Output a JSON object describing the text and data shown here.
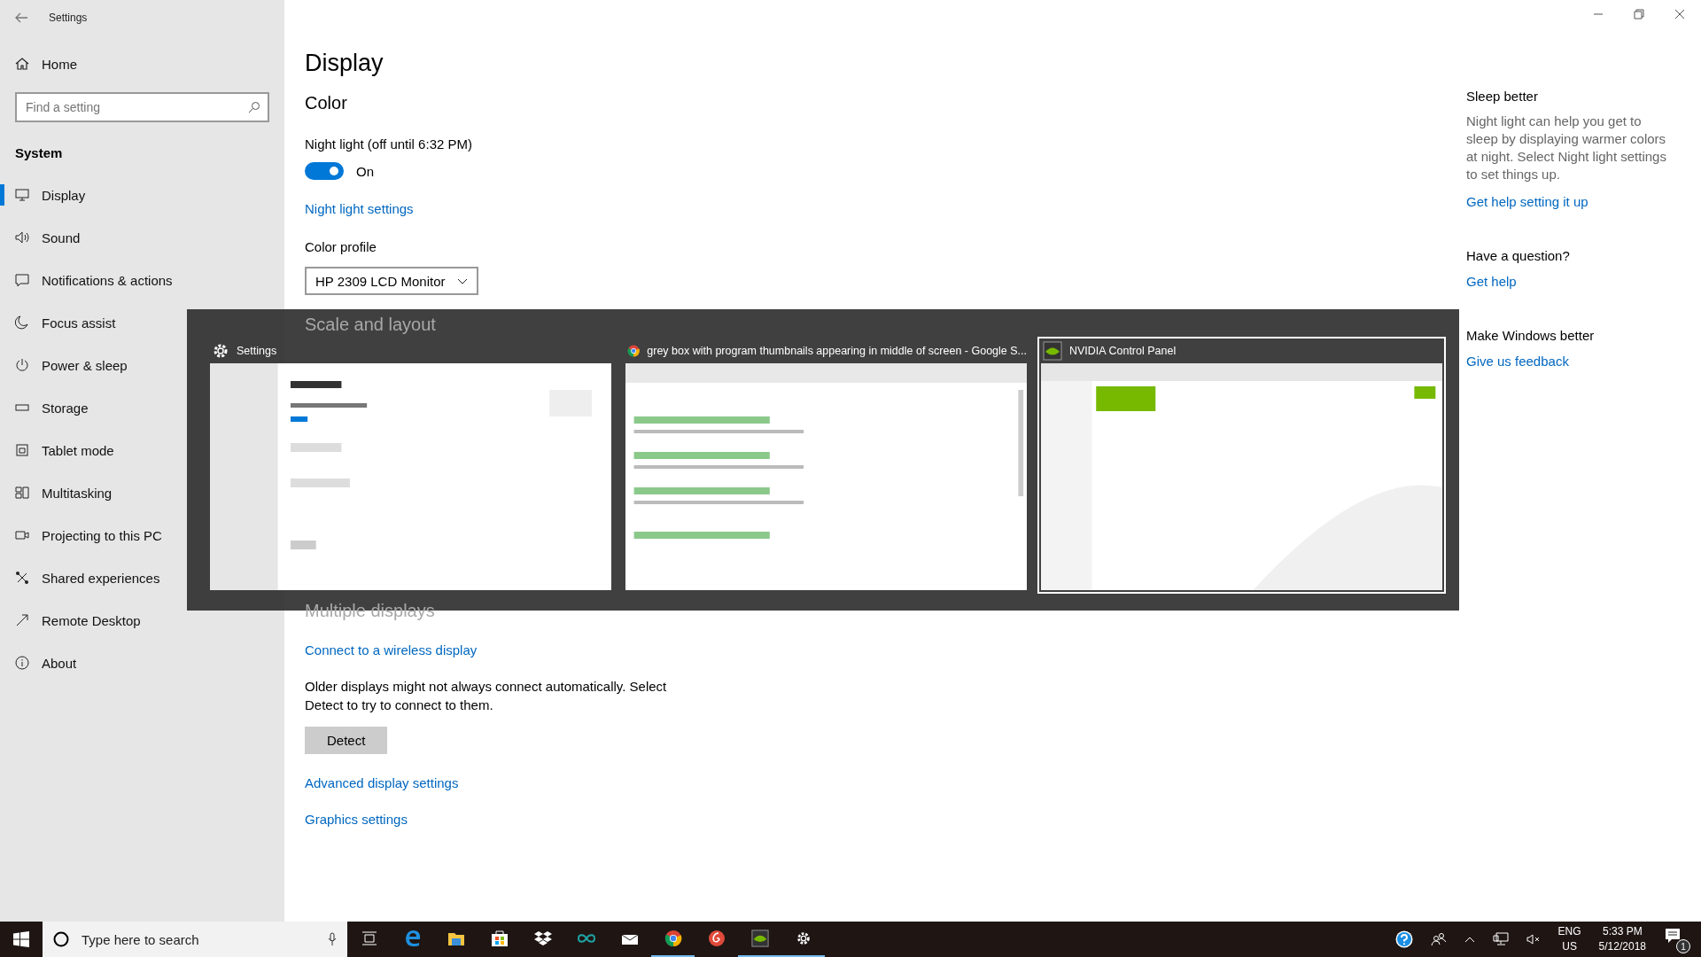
{
  "window": {
    "title": "Settings"
  },
  "sidebar": {
    "home": "Home",
    "search": {
      "placeholder": "Find a setting"
    },
    "section": "System",
    "items": [
      {
        "label": "Display",
        "selected": true
      },
      {
        "label": "Sound",
        "selected": false
      },
      {
        "label": "Notifications & actions",
        "selected": false
      },
      {
        "label": "Focus assist",
        "selected": false
      },
      {
        "label": "Power & sleep",
        "selected": false
      },
      {
        "label": "Storage",
        "selected": false
      },
      {
        "label": "Tablet mode",
        "selected": false
      },
      {
        "label": "Multitasking",
        "selected": false
      },
      {
        "label": "Projecting to this PC",
        "selected": false
      },
      {
        "label": "Shared experiences",
        "selected": false
      },
      {
        "label": "Remote Desktop",
        "selected": false
      },
      {
        "label": "About",
        "selected": false
      }
    ]
  },
  "main": {
    "title": "Display",
    "color_heading": "Color",
    "night_light": {
      "label": "Night light (off until 6:32 PM)",
      "on": true,
      "state_text": "On"
    },
    "night_light_link": "Night light settings",
    "color_profile": {
      "label": "Color profile",
      "value": "HP 2309 LCD Monitor"
    },
    "scale_heading": "Scale and layout",
    "multiple_heading": "Multiple displays",
    "wireless_link": "Connect to a wireless display",
    "older_text": "Older displays might not always connect automatically. Select Detect to try to connect to them.",
    "detect_button": "Detect",
    "advanced_link": "Advanced display settings",
    "graphics_link": "Graphics settings"
  },
  "aside": [
    {
      "heading": "Sleep better",
      "text": "Night light can help you get to sleep by displaying warmer colors at night. Select Night light settings to set things up.",
      "link": "Get help setting it up"
    },
    {
      "heading": "Have a question?",
      "link": "Get help"
    },
    {
      "heading": "Make Windows better",
      "link": "Give us feedback"
    }
  ],
  "switcher": {
    "windows": [
      {
        "kind": "settings",
        "title": "Settings",
        "selected": false
      },
      {
        "kind": "chrome",
        "title": "grey box with program thumbnails appearing in middle of screen - Google S...",
        "selected": false
      },
      {
        "kind": "nvidia",
        "title": "NVIDIA Control Panel",
        "selected": true
      }
    ]
  },
  "taskbar": {
    "search": {
      "placeholder": "Type here to search"
    },
    "apps": [
      {
        "kind": "task-view",
        "running": false
      },
      {
        "kind": "edge",
        "running": false
      },
      {
        "kind": "explorer",
        "running": false
      },
      {
        "kind": "store",
        "running": false
      },
      {
        "kind": "dropbox",
        "running": false
      },
      {
        "kind": "infinity",
        "running": false
      },
      {
        "kind": "mail",
        "running": false
      },
      {
        "kind": "chrome",
        "running": true
      },
      {
        "kind": "spiral",
        "running": false
      },
      {
        "kind": "nvidia",
        "running": true
      },
      {
        "kind": "settings",
        "running": true
      }
    ],
    "language": [
      "ENG",
      "US"
    ],
    "time": "5:33 PM",
    "date": "5/12/2018",
    "notifications": "1"
  }
}
